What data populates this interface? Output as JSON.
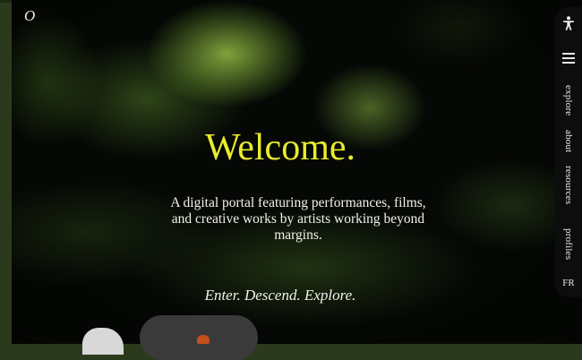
{
  "brand": {
    "logo_letter": "O"
  },
  "hero": {
    "title": "Welcome.",
    "description": "A digital portal featuring performances, films, and creative works by artists working beyond margins.",
    "cta": "Enter. Descend. Explore."
  },
  "sidenav": {
    "accessibility_icon": "accessibility-icon",
    "menu_icon": "hamburger-menu-icon",
    "links": [
      "explore",
      "about",
      "resources",
      "profiles"
    ],
    "language": "FR"
  },
  "colors": {
    "title": "#e8ec2a",
    "text": "#f2f2ea",
    "nav_background": "#0d0d0d",
    "border": "#2b3a1c"
  }
}
